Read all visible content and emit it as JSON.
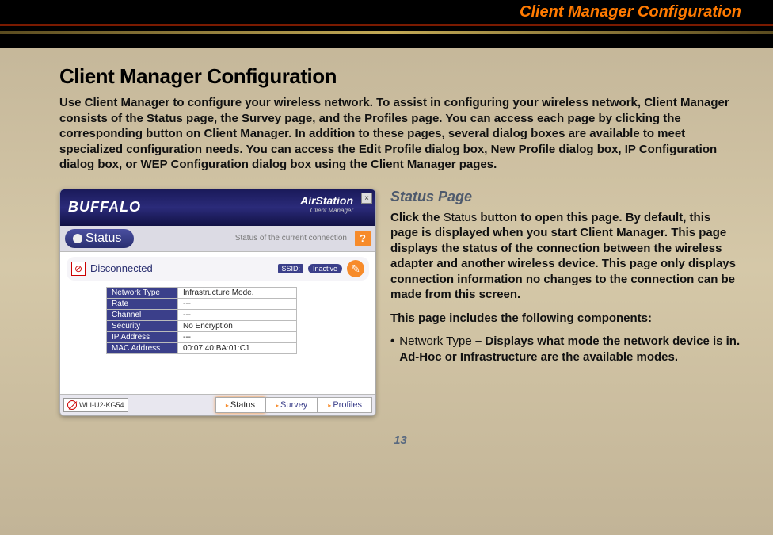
{
  "header": {
    "banner_title": "Client Manager Configuration"
  },
  "content": {
    "title": "Client Manager Configuration",
    "intro": "Use Client Manager to configure your wireless network. To assist in configuring your wireless network, Client Manager consists of the Status page, the Survey page, and the Profiles page. You can access each page by clicking the corresponding button on Client Manager. In addition to these pages, several dialog boxes are available to meet specialized configuration needs. You can access the Edit Profile dialog box, New Profile dialog box, IP Configuration dialog box, or WEP Configuration dialog box using the Client Manager pages.",
    "subtitle": "Status Page",
    "status_para_prefix": "Click the ",
    "status_label": "Status",
    "status_para_suffix": " button to open this page. By default, this page is displayed when you start Client Manager. This page displays the status of the connection between the wireless adapter and another wireless device. This page only displays connection information no changes to the connection can be made from this screen.",
    "components_line": "This page includes the following components:",
    "bullet_label": "Network Type",
    "bullet_text": " – Displays what mode the network device is in.  Ad-Hoc or Infrastructure are the available modes."
  },
  "app": {
    "brand": "BUFFALO",
    "product": "AirStation",
    "product_sub": "Client Manager",
    "close": "×",
    "status_tab": "Status",
    "status_caption": "Status of the current connection",
    "help": "?",
    "conn_state": "Disconnected",
    "ssid_label": "SSID:",
    "inactive": "Inactive",
    "tool": "✎",
    "rows": [
      {
        "k": "Network Type",
        "v": "Infrastructure Mode."
      },
      {
        "k": "Rate",
        "v": "---"
      },
      {
        "k": "Channel",
        "v": "---"
      },
      {
        "k": "Security",
        "v": "No Encryption"
      },
      {
        "k": "IP Address",
        "v": "---"
      },
      {
        "k": "MAC Address",
        "v": "00:07:40:BA:01:C1"
      }
    ],
    "device": "WLI-U2-KG54",
    "tabs": {
      "status": "Status",
      "survey": "Survey",
      "profiles": "Profiles"
    }
  },
  "page_number": "13"
}
